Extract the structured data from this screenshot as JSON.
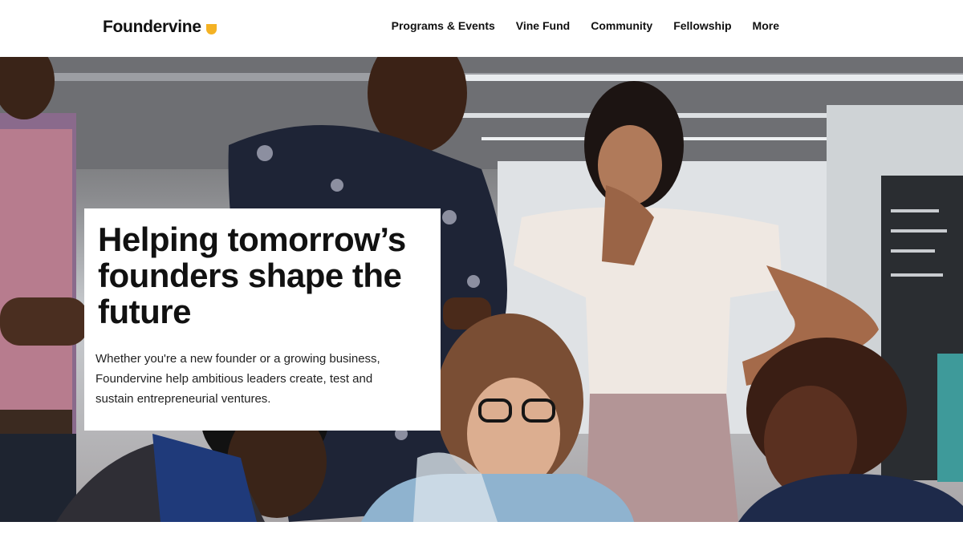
{
  "brand": {
    "name": "Foundervine",
    "accent_color": "#f4b224",
    "logo_icon": "half-circle-icon"
  },
  "nav": {
    "items": [
      {
        "id": "programs-events",
        "label": "Programs & Events"
      },
      {
        "id": "vine-fund",
        "label": "Vine Fund"
      },
      {
        "id": "community",
        "label": "Community"
      },
      {
        "id": "fellowship",
        "label": "Fellowship"
      },
      {
        "id": "more",
        "label": "More"
      }
    ]
  },
  "hero": {
    "title": "Helping tomorrow’s founders shape the future",
    "subtitle": "Whether you're a new founder or a growing business, Foundervine help ambitious leaders create, test and sustain entrepreneurial ventures."
  }
}
